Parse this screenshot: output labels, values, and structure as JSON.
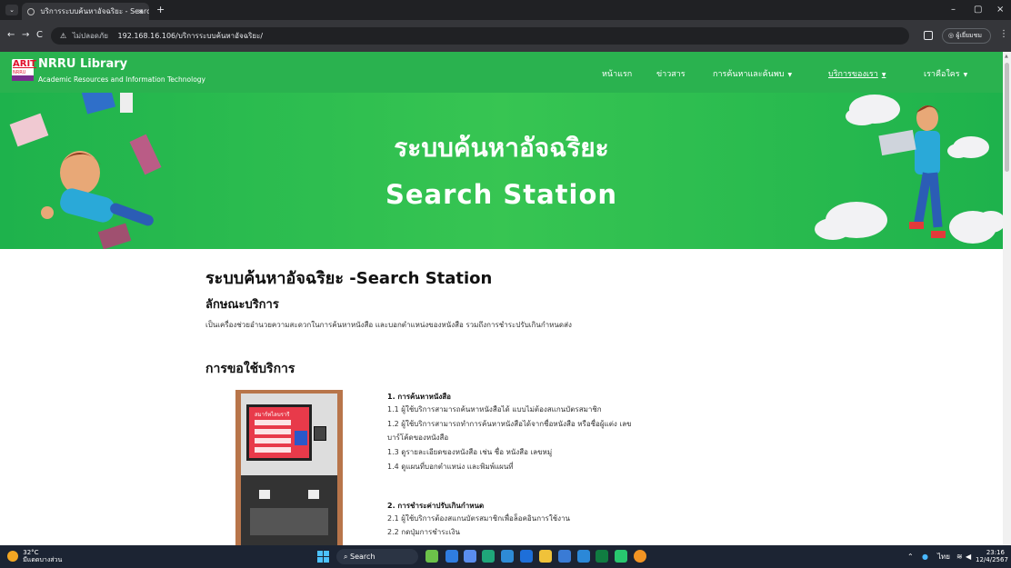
{
  "browser": {
    "tab_title": "บริการระบบค้นหาอัจฉริยะ - Search",
    "tab_close": "×",
    "new_tab": "+",
    "not_secure": "ไม่ปลอดภัย",
    "url": "192.168.16.106/บริการระบบค้นหาอัจฉริยะ/",
    "profile_label": "ผู้เยี่ยมชม",
    "minimize": "–",
    "restore": "▢",
    "close": "×",
    "back": "←",
    "forward": "→",
    "reload": "C",
    "menu": "⋮"
  },
  "site": {
    "logo_top": "ARIT",
    "logo_bottom": "NRRU",
    "brand": "NRRU Library",
    "brand_sub": "Academic Resources and Information Technology",
    "nav": [
      {
        "label": "หน้าแรก",
        "has_caret": false
      },
      {
        "label": "ข่าวสาร",
        "has_caret": false
      },
      {
        "label": "การค้นหาและค้นพบ",
        "has_caret": true
      },
      {
        "label": "บริการของเรา",
        "has_caret": true,
        "active": true
      },
      {
        "label": "เราคือใคร",
        "has_caret": true
      }
    ],
    "caret": "▼"
  },
  "hero": {
    "title_th": "ระบบค้นหาอัจฉริยะ",
    "title_en": "Search Station"
  },
  "content": {
    "page_title": "ระบบค้นหาอัจฉริยะ -Search Station",
    "section_features": "ลักษณะบริการ",
    "description": "เป็นเครื่องช่วยอำนวยความสะดวกในการค้นหาหนังสือ และบอกตำแหน่งของหนังสือ รวมถึงการชำระปรับเกินกำหนดส่ง",
    "section_request": "การขอใช้บริการ",
    "kiosk_screen_title": "สมาร์ทไลบรารี",
    "services": [
      {
        "heading": "1. การค้นหาหนังสือ",
        "items": [
          "1.1 ผู้ใช้บริการสามารถค้นหาหนังสือได้ แบบไม่ต้องสแกนบัตรสมาชิก",
          "1.2 ผู้ใช้บริการสามารถทำการค้นหาหนังสือได้จากชื่อหนังสือ หรือชื่อผู้แต่ง เลข",
          "บาร์โค้ดของหนังสือ",
          "1.3 ดูรายละเอียดของหนังสือ เช่น ชื่อ หนังสือ เลขหมู่",
          "1.4 ดูแผนที่บอกตำแหน่ง และพิมพ์แผนที่"
        ]
      },
      {
        "heading": "2. การชำระค่าปรับเกินกำหนด",
        "items": [
          "2.1 ผู้ใช้บริการต้องสแกนบัตรสมาชิกเพื่อล็อคอินการใช้งาน",
          "2.2 กดปุ่มการชำระเงิน"
        ]
      }
    ]
  },
  "taskbar": {
    "temperature": "32°C",
    "weather_text": "มีแดดบางส่วน",
    "search_label": "Search",
    "time": "23:16",
    "date": "12/4/2567",
    "ime": "ไทย"
  }
}
